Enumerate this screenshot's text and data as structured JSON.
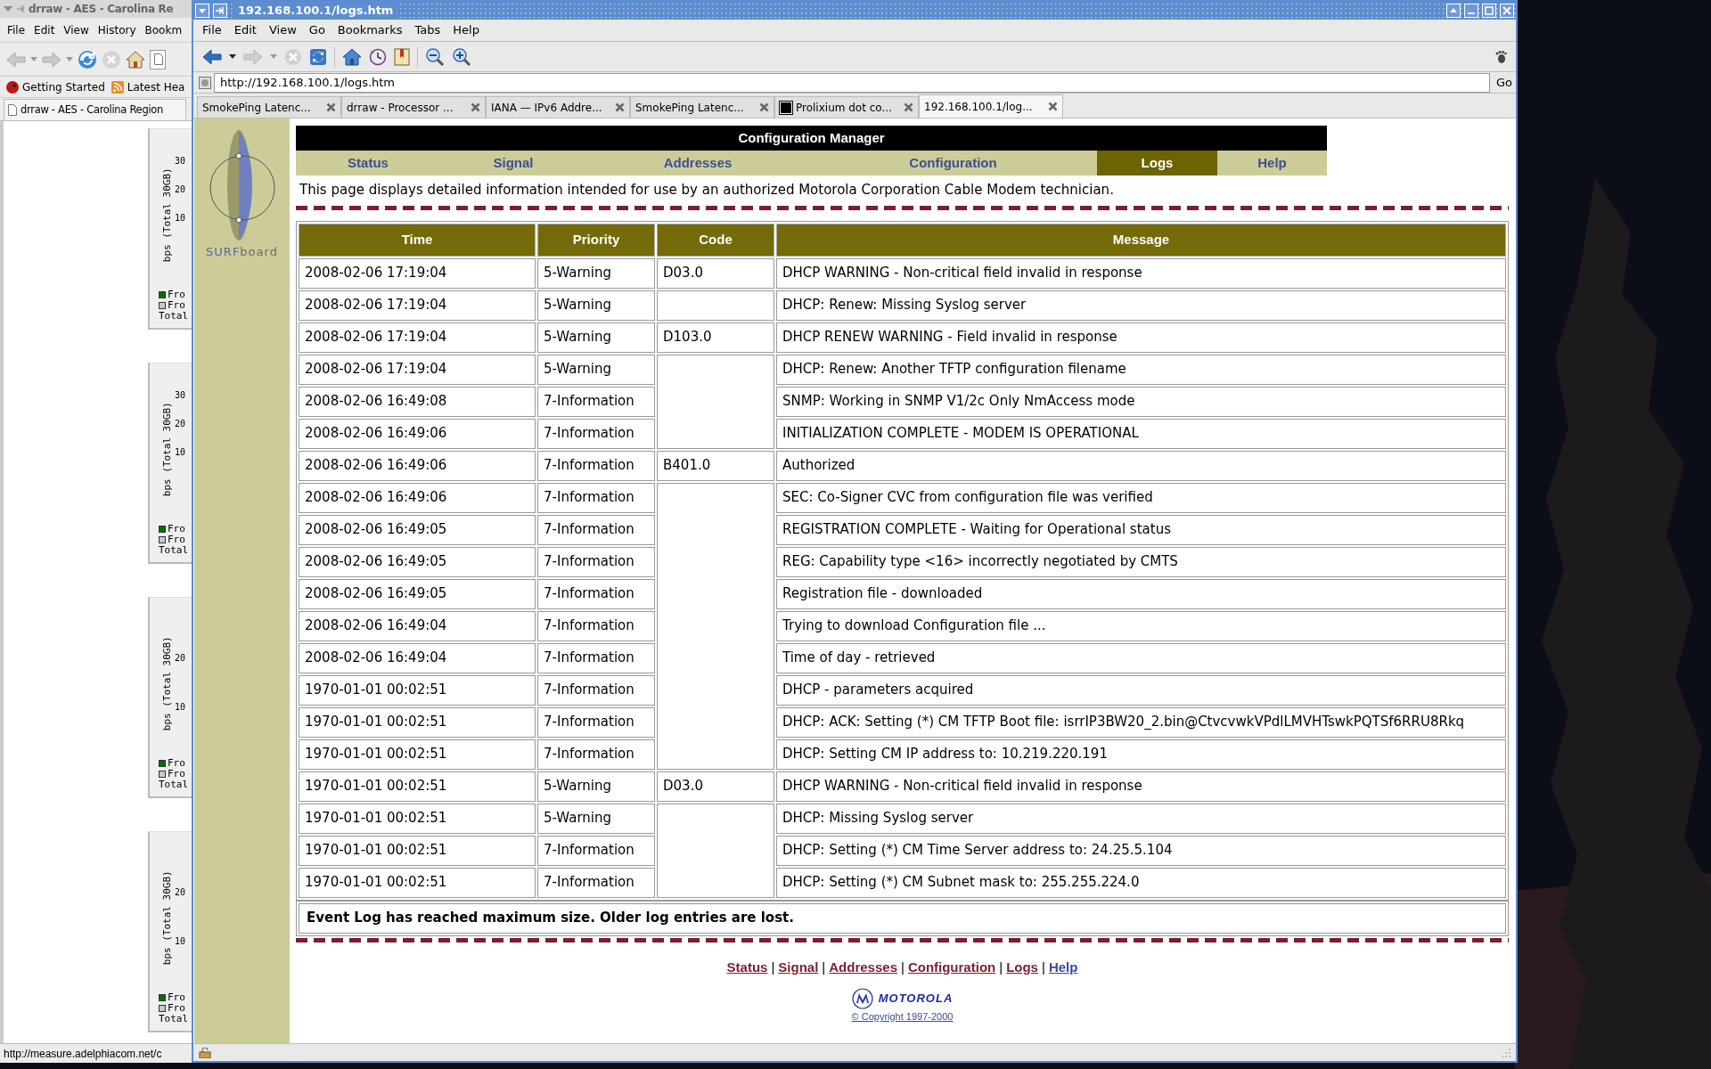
{
  "back_window": {
    "title": "drraw - AES - Carolina Re",
    "menu": [
      "File",
      "Edit",
      "View",
      "History",
      "Bookm"
    ],
    "bookmarks": [
      "Getting Started",
      "Latest Hea"
    ],
    "tab": "drraw - AES - Carolina Region",
    "graphs": [
      {
        "ylabel": "bps (Total 30GB)",
        "ticks": [
          "30",
          "20",
          "10"
        ],
        "legend": [
          {
            "label": "Fro",
            "color": "#007000"
          },
          {
            "label": "Fro",
            "color": "#c8c8c8"
          },
          {
            "label": "Total"
          }
        ]
      },
      {
        "ylabel": "bps (Total 30GB)",
        "ticks": [
          "30",
          "20",
          "10"
        ],
        "legend": [
          {
            "label": "Fro",
            "color": "#007000"
          },
          {
            "label": "Fro",
            "color": "#c8c8c8"
          },
          {
            "label": "Total"
          }
        ]
      },
      {
        "ylabel": "bps (Total 30GB)",
        "ticks": [
          "20",
          "10"
        ],
        "legend": [
          {
            "label": "Fro",
            "color": "#007000"
          },
          {
            "label": "Fro",
            "color": "#c8c8c8"
          },
          {
            "label": "Total"
          }
        ]
      },
      {
        "ylabel": "bps (Total 30GB)",
        "ticks": [
          "20",
          "10"
        ],
        "legend": [
          {
            "label": "Fro",
            "color": "#007000"
          },
          {
            "label": "Fro",
            "color": "#c8c8c8"
          },
          {
            "label": "Total"
          }
        ]
      }
    ],
    "status": "http://measure.adelphiacom.net/c"
  },
  "window": {
    "title": "192.168.100.1/logs.htm",
    "menu": [
      "File",
      "Edit",
      "View",
      "Go",
      "Bookmarks",
      "Tabs",
      "Help"
    ],
    "url": "http://192.168.100.1/logs.htm",
    "go": "Go",
    "tabs": [
      {
        "label": "SmokePing Latenc...",
        "selected": false,
        "has_icon": false
      },
      {
        "label": "drraw - Processor ...",
        "selected": false,
        "has_icon": false
      },
      {
        "label": "IANA — IPv6 Addre...",
        "selected": false,
        "has_icon": false
      },
      {
        "label": "SmokePing Latenc...",
        "selected": false,
        "has_icon": false
      },
      {
        "label": "Prolixium dot co...",
        "selected": false,
        "has_icon": true
      },
      {
        "label": "192.168.100.1/log...",
        "selected": true,
        "has_icon": false
      }
    ]
  },
  "page": {
    "logo": [
      "SURF",
      "board"
    ],
    "header": "Configuration Manager",
    "nav": [
      {
        "label": "Status",
        "selected": false
      },
      {
        "label": "Signal",
        "selected": false
      },
      {
        "label": "Addresses",
        "selected": false
      },
      {
        "label": "Configuration",
        "selected": false
      },
      {
        "label": "Logs",
        "selected": true
      },
      {
        "label": "Help",
        "selected": false
      }
    ],
    "intro": "This page displays detailed information intended for use by an authorized Motorola Corporation Cable Modem technician.",
    "table": {
      "columns": [
        "Time",
        "Priority",
        "Code",
        "Message"
      ],
      "rows": [
        {
          "time": "2008-02-06 17:19:04",
          "priority": "5-Warning",
          "code": "D03.0",
          "message": "DHCP WARNING - Non-critical field invalid in response"
        },
        {
          "time": "2008-02-06 17:19:04",
          "priority": "5-Warning",
          "message": "DHCP: Renew: Missing Syslog server"
        },
        {
          "time": "2008-02-06 17:19:04",
          "priority": "5-Warning",
          "code": "D103.0",
          "message": "DHCP RENEW WARNING - Field invalid in response"
        },
        {
          "time": "2008-02-06 17:19:04",
          "priority": "5-Warning",
          "message": "DHCP: Renew: Another TFTP configuration filename"
        },
        {
          "time": "2008-02-06 16:49:08",
          "priority": "7-Information",
          "message": "SNMP: Working in SNMP V1/2c Only NmAccess mode"
        },
        {
          "time": "2008-02-06 16:49:06",
          "priority": "7-Information",
          "message": "INITIALIZATION COMPLETE - MODEM IS OPERATIONAL"
        },
        {
          "time": "2008-02-06 16:49:06",
          "priority": "7-Information",
          "code": "B401.0",
          "message": "Authorized"
        },
        {
          "time": "2008-02-06 16:49:06",
          "priority": "7-Information",
          "message": "SEC: Co-Signer CVC from configuration file was verified"
        },
        {
          "time": "2008-02-06 16:49:05",
          "priority": "7-Information",
          "message": "REGISTRATION COMPLETE - Waiting for Operational status"
        },
        {
          "time": "2008-02-06 16:49:05",
          "priority": "7-Information",
          "message": "REG: Capability type <16> incorrectly negotiated by CMTS"
        },
        {
          "time": "2008-02-06 16:49:05",
          "priority": "7-Information",
          "message": "Registration file - downloaded"
        },
        {
          "time": "2008-02-06 16:49:04",
          "priority": "7-Information",
          "message": "Trying to download Configuration file ..."
        },
        {
          "time": "2008-02-06 16:49:04",
          "priority": "7-Information",
          "message": "Time of day - retrieved"
        },
        {
          "time": "1970-01-01 00:02:51",
          "priority": "7-Information",
          "message": "DHCP - parameters acquired"
        },
        {
          "time": "1970-01-01 00:02:51",
          "priority": "7-Information",
          "message": "DHCP: ACK: Setting (*) CM TFTP Boot file: isrrIP3BW20_2.bin@CtvcvwkVPdlLMVHTswkPQTSf6RRU8Rkq"
        },
        {
          "time": "1970-01-01 00:02:51",
          "priority": "7-Information",
          "message": "DHCP: Setting CM IP address to: 10.219.220.191"
        },
        {
          "time": "1970-01-01 00:02:51",
          "priority": "5-Warning",
          "code": "D03.0",
          "message": "DHCP WARNING - Non-critical field invalid in response"
        },
        {
          "time": "1970-01-01 00:02:51",
          "priority": "5-Warning",
          "message": "DHCP: Missing Syslog server"
        },
        {
          "time": "1970-01-01 00:02:51",
          "priority": "7-Information",
          "message": "DHCP: Setting (*) CM Time Server address to: 24.25.5.104"
        },
        {
          "time": "1970-01-01 00:02:51",
          "priority": "7-Information",
          "message": "DHCP: Setting (*) CM Subnet mask to: 255.255.224.0"
        }
      ]
    },
    "notice": "Event Log has reached maximum size. Older log entries are lost.",
    "footer_links": [
      {
        "label": "Status",
        "color": "#7a1f30"
      },
      {
        "label": "Signal",
        "color": "#7a1f30"
      },
      {
        "label": "Addresses",
        "color": "#7a1f30"
      },
      {
        "label": "Configuration",
        "color": "#7a1f30"
      },
      {
        "label": "Logs",
        "color": "#7a1f30"
      },
      {
        "label": "Help",
        "color": "#3a4a9a"
      }
    ],
    "separator": "|",
    "brand": "MOTOROLA",
    "copyright": "© Copyright 1997-2000"
  }
}
